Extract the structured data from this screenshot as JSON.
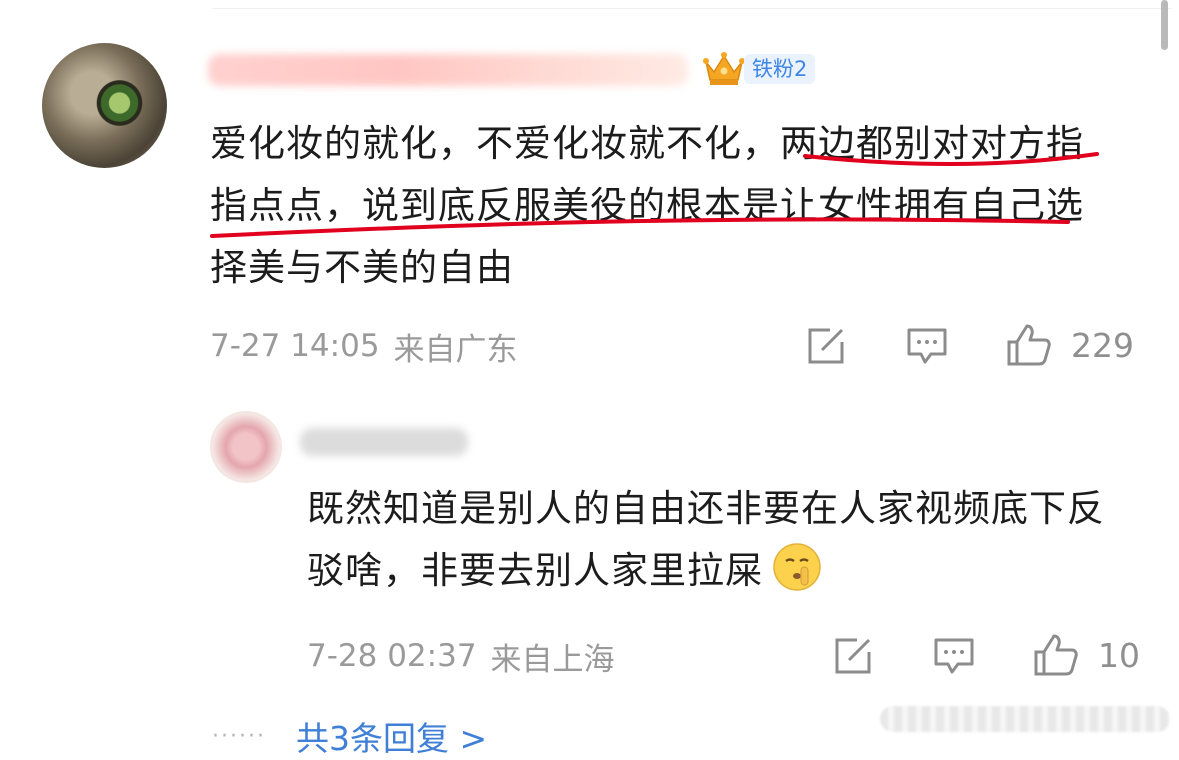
{
  "comments": [
    {
      "author": "",
      "badge": {
        "label": "铁粉2",
        "icon": "crown-icon"
      },
      "text": "爱化妆的就化，不爱化妆就不化，两边都别对对方指指点点，说到底反服美役的根本是让女性拥有自己选择美与不美的自由",
      "date": "7-27 14:05",
      "location": "来自广东",
      "likes": "229"
    },
    {
      "author": "",
      "text": "既然知道是别人的自由还非要在人家视频底下反驳啥，非要去别人家里拉屎",
      "emoji": "shushing-face-icon",
      "date": "7-28 02:37",
      "location": "来自上海",
      "likes": "10"
    }
  ],
  "replies_link": {
    "dots": "······",
    "label": "共3条回复 >"
  },
  "colors": {
    "highlight": "#e1001e",
    "link": "#3f7fd6",
    "meta": "#9a9a9a",
    "badge_text": "#3f86e6"
  }
}
